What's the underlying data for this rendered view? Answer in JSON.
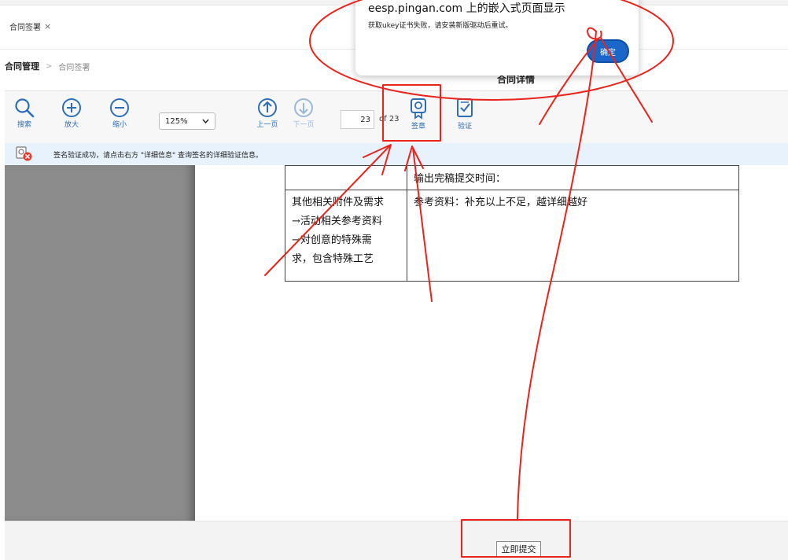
{
  "tabs": [
    {
      "label": "合同签署",
      "close": "×"
    }
  ],
  "breadcrumb": {
    "root": "合同管理",
    "separator": ">",
    "current": "合同签署"
  },
  "detail_title": "合同详情",
  "toolbar": {
    "search": "搜索",
    "zoom_in": "放大",
    "zoom_out": "缩小",
    "zoom_value": "125%",
    "prev_page": "上一页",
    "next_page": "下一页",
    "page_current": "23",
    "page_of": "of 23",
    "sign": "签章",
    "verify": "验证"
  },
  "notice": {
    "text": "签名验证成功，请点击右方 \"详细信息\" 查询签名的详细验证信息。"
  },
  "document": {
    "rows": [
      {
        "left": [
          ""
        ],
        "right": "输出完稿提交时间："
      },
      {
        "left": [
          "其他相关附件及需求",
          "→活动相关参考资料",
          "→对创意的特殊需",
          "求，包含特殊工艺"
        ],
        "right": "参考资料：补充以上不足，越详细越好"
      }
    ]
  },
  "bottom": {
    "submit": "立即提交"
  },
  "dialog": {
    "title": "eesp.pingan.com 上的嵌入式页面显示",
    "message": "获取ukey证书失败，请安装新版驱动后重试。",
    "ok": "确定"
  },
  "colors": {
    "accent": "#2d6db5",
    "dialog_button": "#1a66c9",
    "annotation": "#e8241c"
  }
}
